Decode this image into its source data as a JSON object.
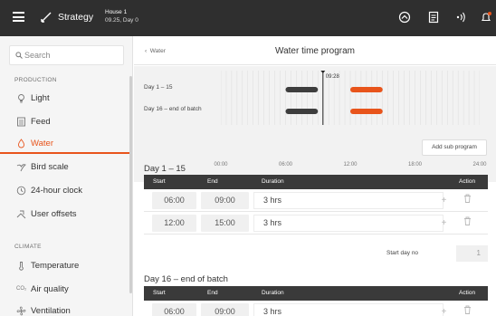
{
  "header": {
    "module": "Strategy",
    "house": "House 1",
    "time_day": "09.25, Day 0"
  },
  "sidebar": {
    "search_placeholder": "Search",
    "sections": [
      {
        "label": "PRODUCTION",
        "items": [
          "Light",
          "Feed",
          "Water",
          "Bird scale",
          "24-hour clock",
          "User offsets"
        ]
      },
      {
        "label": "CLIMATE",
        "items": [
          "Temperature",
          "Air quality",
          "Ventilation"
        ]
      }
    ],
    "active_item": "Water",
    "colors": {
      "accent": "#e8541b"
    }
  },
  "main": {
    "back_label": "Water",
    "title": "Water time program",
    "timeline": {
      "rows": [
        "Day 1 – 15",
        "Day 16 – end of batch"
      ],
      "current_time": "09:28",
      "ticks": [
        "00:00",
        "06:00",
        "12:00",
        "18:00",
        "24:00"
      ],
      "bars": [
        {
          "row": 0,
          "start": "06:00",
          "end": "09:00",
          "state": "past",
          "color": "#3d3d3d"
        },
        {
          "row": 0,
          "start": "12:00",
          "end": "15:00",
          "state": "future",
          "color": "#e8541b"
        },
        {
          "row": 1,
          "start": "06:00",
          "end": "09:00",
          "state": "past",
          "color": "#3d3d3d"
        },
        {
          "row": 1,
          "start": "12:00",
          "end": "15:00",
          "state": "future",
          "color": "#e8541b"
        }
      ]
    },
    "add_sub_program_label": "Add sub program",
    "programs": [
      {
        "title": "Day 1 – 15",
        "columns": {
          "start": "Start",
          "end": "End",
          "duration": "Duration",
          "action": "Action"
        },
        "rows": [
          {
            "start": "06:00",
            "end": "09:00",
            "duration": "3 hrs"
          },
          {
            "start": "12:00",
            "end": "15:00",
            "duration": "3 hrs"
          }
        ],
        "start_day_label": "Start day no",
        "start_day_value": "1"
      },
      {
        "title": "Day 16 – end of batch",
        "columns": {
          "start": "Start",
          "end": "End",
          "duration": "Duration",
          "action": "Action"
        },
        "rows": [
          {
            "start": "06:00",
            "end": "09:00",
            "duration": "3 hrs"
          }
        ]
      }
    ]
  }
}
